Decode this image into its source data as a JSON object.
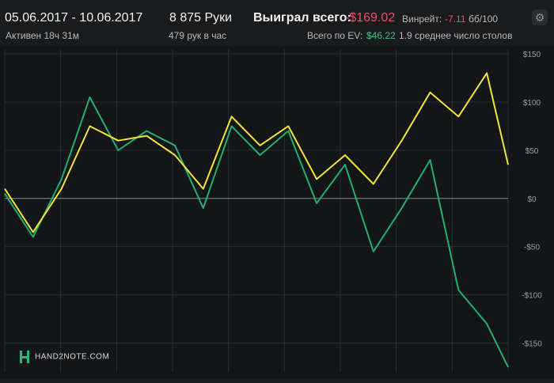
{
  "header": {
    "date_range": "05.06.2017 - 10.06.2017",
    "active_time": "Активен 18ч 31м",
    "hands": "8 875 Руки",
    "hands_per_hour": "479 рук в час",
    "won_total_label": "Выиграл всего:",
    "won_total_value": "-$169.02",
    "ev_label": "Всего по EV:",
    "ev_value": "$46.22",
    "winrate_label": "Винрейт:",
    "winrate_value": "-7.11",
    "winrate_unit": "бб/100",
    "avg_tables": "1.9 среднее число столов"
  },
  "logo": {
    "text": "HAND2NOTE.COM"
  },
  "icons": {
    "settings": "gear-icon",
    "logo": "hand2note-logo-icon"
  },
  "colors": {
    "background": "#141517",
    "net_won_line": "#1fb071",
    "ev_line": "#f0e63a",
    "grid": "#2b2d31",
    "zero_line": "#8a8c90",
    "negative": "#e8516b",
    "positive": "#3ec08b"
  },
  "chart_data": {
    "type": "line",
    "x": [
      0,
      500,
      1000,
      1500,
      2000,
      2500,
      3000,
      3500,
      4000,
      4500,
      5000,
      5500,
      6000,
      6500,
      7000,
      7500,
      8000,
      8500,
      8875
    ],
    "xlim": [
      0,
      8875
    ],
    "ylim": [
      -180,
      155
    ],
    "yticks": [
      -150,
      -100,
      -50,
      0,
      50,
      100,
      150
    ],
    "ytick_labels": [
      "-$150",
      "-$100",
      "-$50",
      "$0",
      "$50",
      "$100",
      "$150"
    ],
    "series": [
      {
        "name": "",
        "color": "#1fb071",
        "values": [
          5,
          -40,
          20,
          105,
          50,
          70,
          55,
          -10,
          75,
          45,
          70,
          -5,
          35,
          -55,
          -10,
          40,
          -95,
          -130,
          -175
        ]
      },
      {
        "name": "",
        "color": "#f0e63a",
        "values": [
          10,
          -35,
          10,
          75,
          60,
          65,
          45,
          10,
          85,
          55,
          75,
          20,
          45,
          15,
          60,
          110,
          85,
          130,
          35
        ]
      }
    ],
    "grid": true,
    "legend": "none",
    "title": "",
    "xlabel": "",
    "ylabel": ""
  }
}
